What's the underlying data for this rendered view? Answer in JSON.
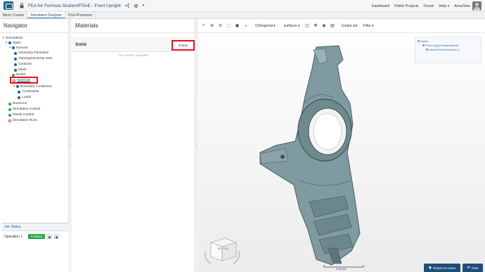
{
  "header": {
    "project_title": "FEA for Formula Student/FSAE - Front Upright",
    "links": [
      "Dashboard",
      "Public Projects",
      "Forum",
      "Help ▾",
      "AnnaTess"
    ]
  },
  "tabs": [
    "Mesh Creator",
    "Simulation Designer",
    "Post-Processor"
  ],
  "active_tab": "Simulation Designer",
  "navigator": {
    "title": "Navigator",
    "items": [
      {
        "label": "Simulations",
        "status": "expand"
      },
      {
        "label": "Static",
        "status": "blue"
      },
      {
        "label": "Domain",
        "status": "blue"
      },
      {
        "label": "Geometry Primitives",
        "status": "blue"
      },
      {
        "label": "Topological Entity Sets",
        "status": "blue"
      },
      {
        "label": "Contacts",
        "status": "blue"
      },
      {
        "label": "Mesh",
        "status": "blue"
      },
      {
        "label": "Model",
        "status": "green"
      },
      {
        "label": "Materials",
        "status": "redring"
      },
      {
        "label": "Boundary Conditions",
        "status": "blue"
      },
      {
        "label": "Constraints",
        "status": "blue"
      },
      {
        "label": "Loads",
        "status": "blue"
      },
      {
        "label": "Numerics",
        "status": "green"
      },
      {
        "label": "Simulation Control",
        "status": "green"
      },
      {
        "label": "Result Control",
        "status": "green"
      },
      {
        "label": "Simulation Runs",
        "status": "redring"
      }
    ]
  },
  "job_status": {
    "title": "Job Status",
    "operation": "Operation 1",
    "status": "Finished"
  },
  "materials": {
    "title": "Materials",
    "section": "Solid",
    "new_label": "New",
    "empty_text": "No entries available"
  },
  "viewer": {
    "projection": "Orthogonal",
    "render_mode": "surfaces",
    "create_set": "Create set",
    "filter": "Filter",
    "scene": {
      "root": "Scene",
      "model": "Front Upright NaamMyvesh",
      "volume": "volumeOnGeoVolumes_0"
    },
    "cube_face": "BOTTOM",
    "scale_label": "0.05 [m]"
  },
  "footer": {
    "report": "Report an issue",
    "chat": "Chat"
  },
  "colors": {
    "brand": "#1f4e79",
    "accent": "#2b78b8",
    "success": "#27a844",
    "highlight": "#e0161b",
    "part": "#7a9499"
  }
}
